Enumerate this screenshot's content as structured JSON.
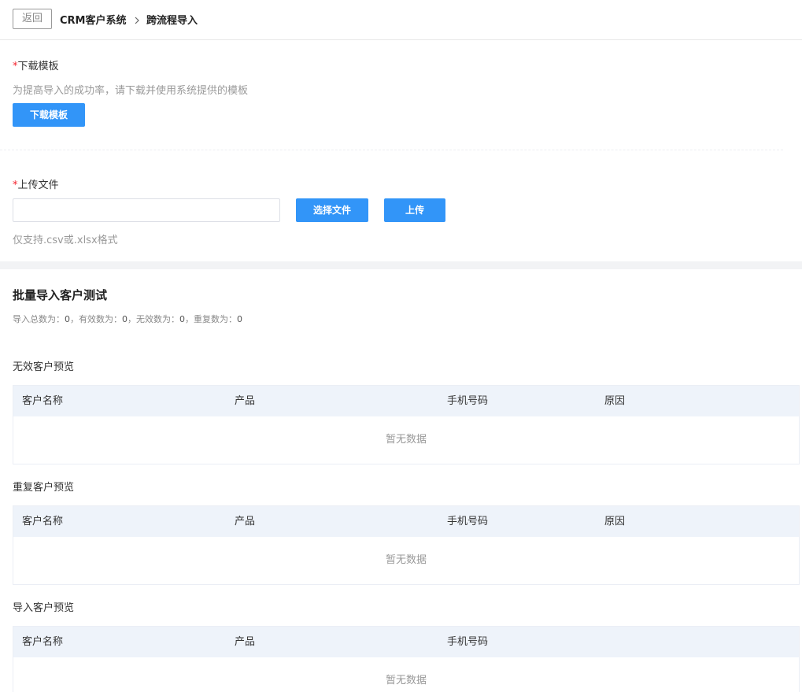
{
  "header": {
    "back_label": "返回",
    "system_name": "CRM客户系统",
    "current_page": "跨流程导入"
  },
  "download": {
    "required_mark": "*",
    "label": "下载模板",
    "hint": "为提高导入的成功率，请下载并使用系统提供的模板",
    "button": "下载模板"
  },
  "upload": {
    "required_mark": "*",
    "label": "上传文件",
    "file_value": "",
    "choose_button": "选择文件",
    "upload_button": "上传",
    "hint": "仅支持.csv或.xlsx格式"
  },
  "batch": {
    "title": "批量导入客户测试",
    "stats": {
      "total_label": "导入总数为：",
      "total": "0",
      "valid_label": "，有效数为：",
      "valid": "0",
      "invalid_label": "，无效数为：",
      "invalid": "0",
      "dup_label": "，重复数为：",
      "dup": "0"
    }
  },
  "tables": {
    "invalid": {
      "title": "无效客户预览",
      "columns": [
        "客户名称",
        "产品",
        "手机号码",
        "原因"
      ],
      "empty": "暂无数据"
    },
    "duplicate": {
      "title": "重复客户预览",
      "columns": [
        "客户名称",
        "产品",
        "手机号码",
        "原因"
      ],
      "empty": "暂无数据"
    },
    "imported": {
      "title": "导入客户预览",
      "columns": [
        "客户名称",
        "产品",
        "手机号码"
      ],
      "empty": "暂无数据"
    }
  }
}
